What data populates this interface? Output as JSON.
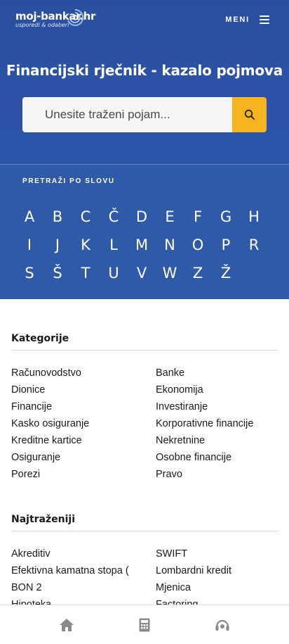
{
  "header": {
    "logo_main": "moj-bankar.hr",
    "logo_sub": "usporedi & odaberi",
    "menu_label": "MENI"
  },
  "hero": {
    "title": "Financijski rječnik - kazalo pojmova",
    "search_placeholder": "Unesite traženi pojam..."
  },
  "letters": {
    "label": "PRETRAŽI PO SLOVU",
    "items": [
      "A",
      "B",
      "C",
      "Č",
      "D",
      "E",
      "F",
      "G",
      "H",
      "I",
      "J",
      "K",
      "L",
      "M",
      "N",
      "O",
      "P",
      "R",
      "S",
      "Š",
      "T",
      "U",
      "V",
      "W",
      "Z",
      "Ž"
    ]
  },
  "categories": {
    "title": "Kategorije",
    "items": [
      "Računovodstvo",
      "Banke",
      "Dionice",
      "Ekonomija",
      "Financije",
      "Investiranje",
      "Kasko osiguranje",
      "Korporativne financije",
      "Kreditne kartice",
      "Nekretnine",
      "Osiguranje",
      "Osobne financije",
      "Porezi",
      "Pravo"
    ]
  },
  "popular": {
    "title": "Najtraženiji",
    "items": [
      "Akreditiv",
      "SWIFT",
      "Efektivna kamatna stopa (",
      "Lombardni kredit",
      "BON 2",
      "Mjenica",
      "Hipoteka",
      "Factoring"
    ]
  },
  "bottom_nav": {
    "items": [
      "home-icon",
      "calculator-icon",
      "headset-icon"
    ]
  },
  "colors": {
    "hero_blue": "#2e59b0",
    "search_button": "#f6b51e"
  }
}
